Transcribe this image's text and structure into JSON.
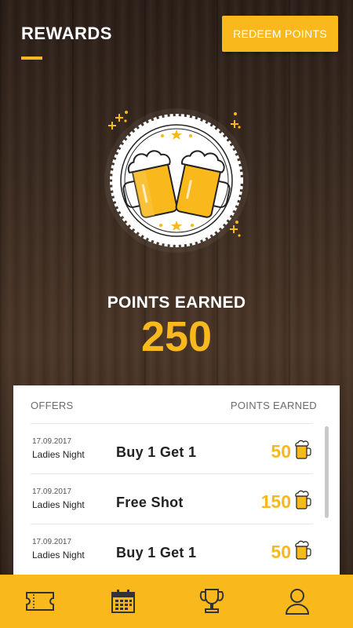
{
  "header": {
    "title": "REWARDS",
    "redeem_label": "REDEEM POINTS"
  },
  "summary": {
    "label": "POINTS EARNED",
    "value": "250"
  },
  "offers": {
    "col_offers": "OFFERS",
    "col_points": "POINTS EARNED",
    "rows": [
      {
        "date": "17.09.2017",
        "venue": "Ladies Night",
        "offer": "Buy 1 Get 1",
        "points": "50"
      },
      {
        "date": "17.09.2017",
        "venue": "Ladies Night",
        "offer": "Free Shot",
        "points": "150"
      },
      {
        "date": "17.09.2017",
        "venue": "Ladies Night",
        "offer": "Buy 1 Get 1",
        "points": "50"
      }
    ]
  },
  "nav": {
    "items": [
      {
        "icon": "ticket-icon"
      },
      {
        "icon": "calendar-icon"
      },
      {
        "icon": "trophy-icon"
      },
      {
        "icon": "user-icon"
      }
    ]
  },
  "colors": {
    "accent": "#f9b81c",
    "text_dark": "#222222",
    "card_bg": "#ffffff"
  }
}
